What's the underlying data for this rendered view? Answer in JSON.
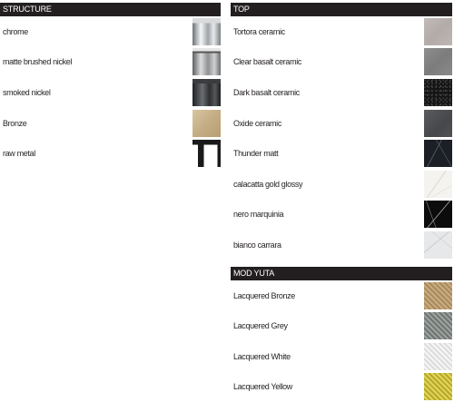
{
  "structure": {
    "title": "STRUCTURE",
    "items": [
      {
        "label": "chrome",
        "swatch": "chrome-finish"
      },
      {
        "label": "matte brushed nickel",
        "swatch": "matte-brushed-nickel-finish"
      },
      {
        "label": "smoked nickel",
        "swatch": "smoked-nickel-finish"
      },
      {
        "label": "Bronze",
        "swatch": "bronze-finish"
      },
      {
        "label": "raw metal",
        "swatch": "raw-metal-finish"
      }
    ]
  },
  "top": {
    "title": "TOP",
    "items": [
      {
        "label": "Tortora ceramic",
        "color": "#b8b0ad"
      },
      {
        "label": "Clear basalt ceramic",
        "color": "#858585"
      },
      {
        "label": "Dark basalt ceramic",
        "color": "#1a1a1a"
      },
      {
        "label": "Oxide ceramic",
        "color": "#4d4f52"
      },
      {
        "label": "Thunder matt",
        "color": "#1c1f26"
      },
      {
        "label": "calacatta gold glossy",
        "color": "#f4f3f0"
      },
      {
        "label": "nero marquinia",
        "color": "#0c0c0c"
      },
      {
        "label": "bianco carrara",
        "color": "#e7e8ea"
      }
    ]
  },
  "mod_yuta": {
    "title": "MOD YUTA",
    "items": [
      {
        "label": "Lacquered Bronze",
        "color": "#b89a6c"
      },
      {
        "label": "Lacquered Grey",
        "color": "#858c88"
      },
      {
        "label": "Lacquered White",
        "color": "#ececec"
      },
      {
        "label": "Lacquered Yellow",
        "color": "#d4c848"
      }
    ]
  },
  "colors": {
    "header_bg": "#231f20",
    "header_text": "#ffffff",
    "text": "#231f20"
  }
}
